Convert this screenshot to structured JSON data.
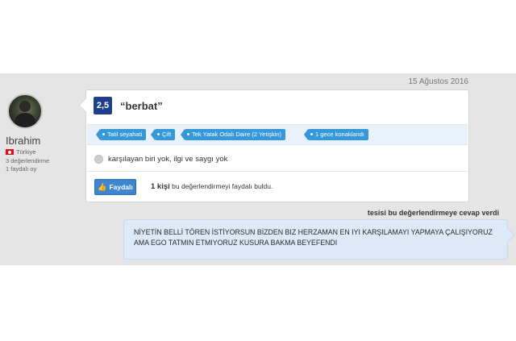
{
  "review": {
    "date": "15 Ağustos 2016",
    "user": {
      "name": "Ibrahim",
      "country": "Türkiye",
      "review_count": "3 değerlendirme",
      "helpful_votes": "1 faydalı oy"
    },
    "score": "2,5",
    "title": "“berbat”",
    "tags": [
      "Tatil seyahati",
      "Çift",
      "Tek Yatak Odalı Daire (2 Yetişkin)",
      "1 gece konaklandı"
    ],
    "negative_comment": "karşılayan biri yok, ilgi ve saygı yok",
    "helpful_button": "Faydalı",
    "helpful_count": "1 kişi",
    "helpful_suffix": "bu değerlendirmeyi faydalı buldu."
  },
  "response": {
    "heading": "tesisi bu değerlendirmeye cevap verdi",
    "text": "NİYETİN BELLİ TÖREN İSTİYORSUN BİZDEN BIZ HERZAMAN EN IYI KARŞILAMAYI YAPMAYA ÇALIŞIYORUZ AMA EGO TATMIN ETMIYORUZ KUSURA BAKMA BEYEFENDI"
  },
  "colors": {
    "score_bg": "#1f3f8a",
    "tag_bg": "#3598db",
    "button_bg": "#3e86d2",
    "reply_bg": "#dceaf8"
  }
}
